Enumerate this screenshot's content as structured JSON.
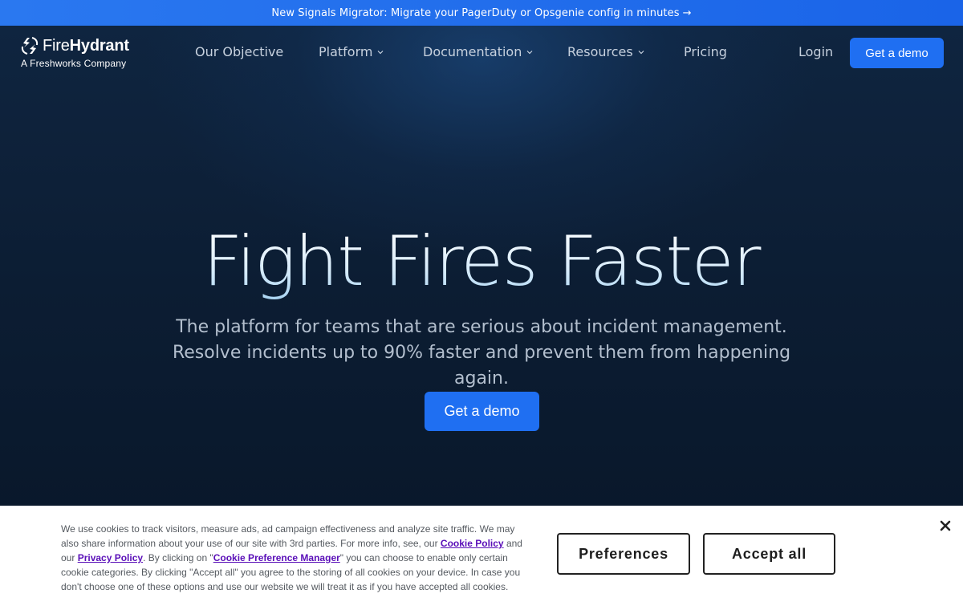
{
  "announcement": {
    "text": "New Signals Migrator: Migrate your PagerDuty or Opsgenie config in minutes",
    "arrow": "→"
  },
  "brand": {
    "name_light": "Fire",
    "name_bold": "Hydrant",
    "tagline": "A Freshworks Company",
    "logo_icon": "firehydrant-logo-icon"
  },
  "nav": {
    "items": [
      {
        "label": "Our Objective",
        "dropdown": false
      },
      {
        "label": "Platform",
        "dropdown": true
      },
      {
        "label": "Documentation",
        "dropdown": true
      },
      {
        "label": "Resources",
        "dropdown": true
      },
      {
        "label": "Pricing",
        "dropdown": false
      }
    ],
    "login": "Login",
    "cta": "Get a demo"
  },
  "hero": {
    "title": "Fight Fires Faster",
    "subtitle": "The platform for teams that are serious about incident management. Resolve incidents up to 90% faster and prevent them from happening again.",
    "cta": "Get a demo"
  },
  "cookie_banner": {
    "text_1": "We use cookies to track visitors, measure ads, ad campaign effectiveness and analyze site traffic. We may also share information about your use of our site with 3rd parties. For more info, see, our ",
    "link_cookie_policy": "Cookie Policy",
    "text_2": " and our ",
    "link_privacy_policy": "Privacy Policy",
    "text_3": ". By clicking on \"",
    "link_preference_manager": "Cookie Preference Manager",
    "text_4": "\" you can choose to enable only certain cookie categories. By clicking \"Accept all\" you agree to the storing of all cookies on your device. In case you don't choose one of these options and use our website we will treat it as if you have accepted all cookies.",
    "preferences_button": "Preferences",
    "accept_button": "Accept all",
    "close_icon": "close-icon"
  },
  "colors": {
    "announcement_bg": "#1f6ff2",
    "primary_button": "#1f6ff2",
    "hero_bg": "#0c1d33",
    "link_purple": "#5a0fb8"
  }
}
